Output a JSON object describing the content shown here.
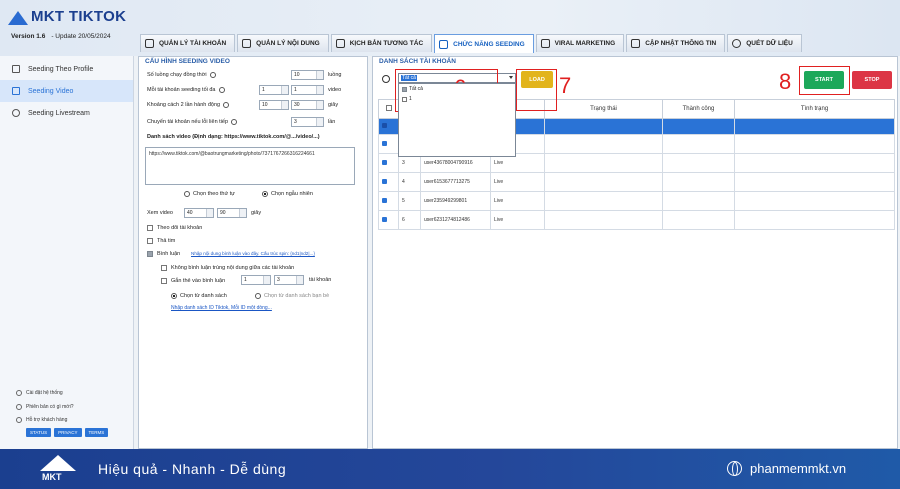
{
  "app": {
    "name": "MKT TIKTOK",
    "version": "Version 1.6",
    "update": "- Update 20/05/2024"
  },
  "tabs": [
    {
      "label": "QUẢN LÝ TÀI KHOẢN",
      "icon": "table-icon"
    },
    {
      "label": "QUẢN LÝ NỘI DUNG",
      "icon": "document-icon"
    },
    {
      "label": "KỊCH BẢN TƯƠNG TÁC",
      "icon": "hand-icon"
    },
    {
      "label": "CHỨC NĂNG SEEDING",
      "icon": "grid-icon",
      "active": true
    },
    {
      "label": "VIRAL MARKETING",
      "icon": "grid-icon"
    },
    {
      "label": "CẬP NHẬT THÔNG TIN",
      "icon": "edit-icon"
    },
    {
      "label": "QUÉT DỮ LIỆU",
      "icon": "globe-icon"
    }
  ],
  "sidebar": {
    "items": [
      {
        "label": "Seeding Theo Profile"
      },
      {
        "label": "Seeding Video",
        "active": true
      },
      {
        "label": "Seeding Livestream"
      }
    ],
    "links": [
      "Cài đặt hệ thống",
      "Phiên bản có gì mới?",
      "Hỗ trợ khách hàng"
    ],
    "buttons": [
      "STATUS",
      "PRIVACY",
      "TERMS"
    ]
  },
  "config": {
    "title": "CẤU HÌNH SEEDING VIDEO",
    "threads_label": "Số luồng chạy đồng thời",
    "threads_value": "10",
    "threads_unit": "luồng",
    "max_per_account_label": "Mỗi tài khoản seeding tối đa",
    "max_from": "1",
    "max_to": "1",
    "max_unit": "video",
    "delay_label": "Khoảng cách 2 lần hành động",
    "delay_from": "10",
    "delay_to": "30",
    "delay_unit": "giây",
    "switch_label": "Chuyển tài khoản nếu lỗi liên tiếp",
    "switch_value": "3",
    "switch_unit": "lần",
    "video_list_label": "Danh sách video (Định dạng: https://www.tiktok.com/@.../video/...)",
    "video_list_value": "https://www.tiktok.com/@baotrungmarketing/photo/7371767266316224661",
    "order_sequential": "Chọn theo thứ tự",
    "order_random": "Chọn ngẫu nhiên",
    "watch_label": "Xem video",
    "watch_from": "40",
    "watch_to": "90",
    "watch_unit": "giây",
    "follow_label": "Theo dõi tài khoản",
    "heart_label": "Thả tim",
    "comment_label": "Bình luận",
    "comment_link": "Nhập nội dung bình luận vào đây. Cấu trúc spin: {nd1|nd2|...}",
    "no_dup_label": "Không bình luận trùng nội dung giữa các tài khoản",
    "tag_label": "Gắn thẻ vào bình luận",
    "tag_from": "1",
    "tag_to": "3",
    "tag_unit": "tài khoản",
    "from_list": "Chọn từ danh sách",
    "from_friends": "Chọn từ danh sách bạn bè",
    "id_list_link": "Nhập danh sách ID Tiktok, Mỗi ID một dòng..."
  },
  "accounts": {
    "title": "DANH SÁCH TÀI KHOẢN",
    "filter_value": "Tất cả",
    "dropdown_options": [
      "Tất cả",
      "1"
    ],
    "load_label": "LOAD",
    "start_label": "START",
    "stop_label": "STOP",
    "columns": [
      "",
      "",
      "",
      "",
      "Trạng thái",
      "Thành công",
      "Tình trạng"
    ],
    "rows": [
      {
        "num": "",
        "user": "",
        "status": ""
      },
      {
        "num": "",
        "user": "",
        "status": ""
      },
      {
        "num": "3",
        "user": "user43678004790916",
        "status": "Live"
      },
      {
        "num": "4",
        "user": "user6153677713275",
        "status": "Live"
      },
      {
        "num": "5",
        "user": "user235949299801",
        "status": "Live"
      },
      {
        "num": "6",
        "user": "user6231274812486",
        "status": "Live"
      }
    ]
  },
  "annotations": {
    "n6": "6",
    "n7": "7",
    "n8": "8"
  },
  "footer": {
    "slogan": "Hiệu quả - Nhanh - Dễ dùng",
    "website": "phanmemmkt.vn",
    "logo_text": "MKT"
  },
  "colors": {
    "accent": "#2a73d6",
    "load": "#e2b41c",
    "start": "#1ca85a",
    "stop": "#dc3545",
    "annotation": "#e02020",
    "footer": "#1b3f8f"
  }
}
